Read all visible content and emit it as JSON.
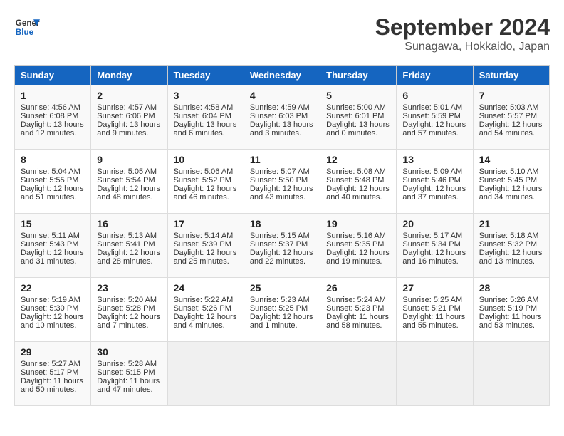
{
  "header": {
    "logo_line1": "General",
    "logo_line2": "Blue",
    "month": "September 2024",
    "location": "Sunagawa, Hokkaido, Japan"
  },
  "weekdays": [
    "Sunday",
    "Monday",
    "Tuesday",
    "Wednesday",
    "Thursday",
    "Friday",
    "Saturday"
  ],
  "weeks": [
    [
      {
        "day": "1",
        "lines": [
          "Sunrise: 4:56 AM",
          "Sunset: 6:08 PM",
          "Daylight: 13 hours",
          "and 12 minutes."
        ]
      },
      {
        "day": "2",
        "lines": [
          "Sunrise: 4:57 AM",
          "Sunset: 6:06 PM",
          "Daylight: 13 hours",
          "and 9 minutes."
        ]
      },
      {
        "day": "3",
        "lines": [
          "Sunrise: 4:58 AM",
          "Sunset: 6:04 PM",
          "Daylight: 13 hours",
          "and 6 minutes."
        ]
      },
      {
        "day": "4",
        "lines": [
          "Sunrise: 4:59 AM",
          "Sunset: 6:03 PM",
          "Daylight: 13 hours",
          "and 3 minutes."
        ]
      },
      {
        "day": "5",
        "lines": [
          "Sunrise: 5:00 AM",
          "Sunset: 6:01 PM",
          "Daylight: 13 hours",
          "and 0 minutes."
        ]
      },
      {
        "day": "6",
        "lines": [
          "Sunrise: 5:01 AM",
          "Sunset: 5:59 PM",
          "Daylight: 12 hours",
          "and 57 minutes."
        ]
      },
      {
        "day": "7",
        "lines": [
          "Sunrise: 5:03 AM",
          "Sunset: 5:57 PM",
          "Daylight: 12 hours",
          "and 54 minutes."
        ]
      }
    ],
    [
      {
        "day": "8",
        "lines": [
          "Sunrise: 5:04 AM",
          "Sunset: 5:55 PM",
          "Daylight: 12 hours",
          "and 51 minutes."
        ]
      },
      {
        "day": "9",
        "lines": [
          "Sunrise: 5:05 AM",
          "Sunset: 5:54 PM",
          "Daylight: 12 hours",
          "and 48 minutes."
        ]
      },
      {
        "day": "10",
        "lines": [
          "Sunrise: 5:06 AM",
          "Sunset: 5:52 PM",
          "Daylight: 12 hours",
          "and 46 minutes."
        ]
      },
      {
        "day": "11",
        "lines": [
          "Sunrise: 5:07 AM",
          "Sunset: 5:50 PM",
          "Daylight: 12 hours",
          "and 43 minutes."
        ]
      },
      {
        "day": "12",
        "lines": [
          "Sunrise: 5:08 AM",
          "Sunset: 5:48 PM",
          "Daylight: 12 hours",
          "and 40 minutes."
        ]
      },
      {
        "day": "13",
        "lines": [
          "Sunrise: 5:09 AM",
          "Sunset: 5:46 PM",
          "Daylight: 12 hours",
          "and 37 minutes."
        ]
      },
      {
        "day": "14",
        "lines": [
          "Sunrise: 5:10 AM",
          "Sunset: 5:45 PM",
          "Daylight: 12 hours",
          "and 34 minutes."
        ]
      }
    ],
    [
      {
        "day": "15",
        "lines": [
          "Sunrise: 5:11 AM",
          "Sunset: 5:43 PM",
          "Daylight: 12 hours",
          "and 31 minutes."
        ]
      },
      {
        "day": "16",
        "lines": [
          "Sunrise: 5:13 AM",
          "Sunset: 5:41 PM",
          "Daylight: 12 hours",
          "and 28 minutes."
        ]
      },
      {
        "day": "17",
        "lines": [
          "Sunrise: 5:14 AM",
          "Sunset: 5:39 PM",
          "Daylight: 12 hours",
          "and 25 minutes."
        ]
      },
      {
        "day": "18",
        "lines": [
          "Sunrise: 5:15 AM",
          "Sunset: 5:37 PM",
          "Daylight: 12 hours",
          "and 22 minutes."
        ]
      },
      {
        "day": "19",
        "lines": [
          "Sunrise: 5:16 AM",
          "Sunset: 5:35 PM",
          "Daylight: 12 hours",
          "and 19 minutes."
        ]
      },
      {
        "day": "20",
        "lines": [
          "Sunrise: 5:17 AM",
          "Sunset: 5:34 PM",
          "Daylight: 12 hours",
          "and 16 minutes."
        ]
      },
      {
        "day": "21",
        "lines": [
          "Sunrise: 5:18 AM",
          "Sunset: 5:32 PM",
          "Daylight: 12 hours",
          "and 13 minutes."
        ]
      }
    ],
    [
      {
        "day": "22",
        "lines": [
          "Sunrise: 5:19 AM",
          "Sunset: 5:30 PM",
          "Daylight: 12 hours",
          "and 10 minutes."
        ]
      },
      {
        "day": "23",
        "lines": [
          "Sunrise: 5:20 AM",
          "Sunset: 5:28 PM",
          "Daylight: 12 hours",
          "and 7 minutes."
        ]
      },
      {
        "day": "24",
        "lines": [
          "Sunrise: 5:22 AM",
          "Sunset: 5:26 PM",
          "Daylight: 12 hours",
          "and 4 minutes."
        ]
      },
      {
        "day": "25",
        "lines": [
          "Sunrise: 5:23 AM",
          "Sunset: 5:25 PM",
          "Daylight: 12 hours",
          "and 1 minute."
        ]
      },
      {
        "day": "26",
        "lines": [
          "Sunrise: 5:24 AM",
          "Sunset: 5:23 PM",
          "Daylight: 11 hours",
          "and 58 minutes."
        ]
      },
      {
        "day": "27",
        "lines": [
          "Sunrise: 5:25 AM",
          "Sunset: 5:21 PM",
          "Daylight: 11 hours",
          "and 55 minutes."
        ]
      },
      {
        "day": "28",
        "lines": [
          "Sunrise: 5:26 AM",
          "Sunset: 5:19 PM",
          "Daylight: 11 hours",
          "and 53 minutes."
        ]
      }
    ],
    [
      {
        "day": "29",
        "lines": [
          "Sunrise: 5:27 AM",
          "Sunset: 5:17 PM",
          "Daylight: 11 hours",
          "and 50 minutes."
        ]
      },
      {
        "day": "30",
        "lines": [
          "Sunrise: 5:28 AM",
          "Sunset: 5:15 PM",
          "Daylight: 11 hours",
          "and 47 minutes."
        ]
      },
      {
        "day": "",
        "lines": []
      },
      {
        "day": "",
        "lines": []
      },
      {
        "day": "",
        "lines": []
      },
      {
        "day": "",
        "lines": []
      },
      {
        "day": "",
        "lines": []
      }
    ]
  ]
}
